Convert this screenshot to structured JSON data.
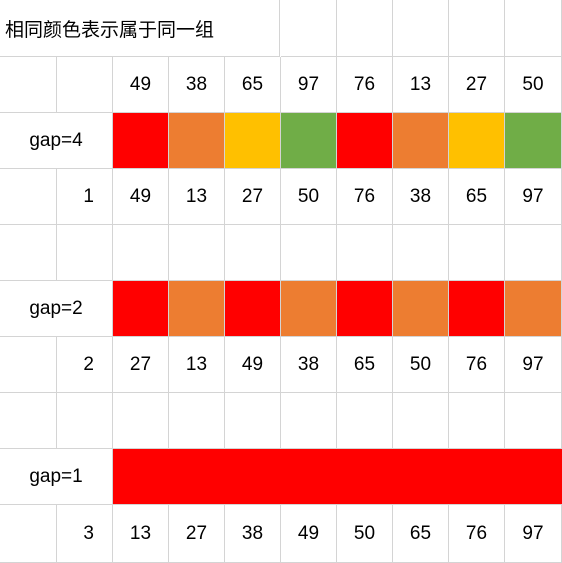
{
  "title": "相同颜色表示属于同一组",
  "colors": {
    "red": "#ff0000",
    "orange": "#ed7d31",
    "yellow": "#ffc000",
    "green": "#70ad47"
  },
  "initial": [
    "49",
    "38",
    "65",
    "97",
    "76",
    "13",
    "27",
    "50"
  ],
  "passes": [
    {
      "label": "gap=4",
      "step": "1",
      "groups": [
        "red",
        "orange",
        "yellow",
        "green",
        "red",
        "orange",
        "yellow",
        "green"
      ],
      "result": [
        "49",
        "13",
        "27",
        "50",
        "76",
        "38",
        "65",
        "97"
      ]
    },
    {
      "label": "gap=2",
      "step": "2",
      "groups": [
        "red",
        "orange",
        "red",
        "orange",
        "red",
        "orange",
        "red",
        "orange"
      ],
      "result": [
        "27",
        "13",
        "49",
        "38",
        "65",
        "50",
        "76",
        "97"
      ]
    },
    {
      "label": "gap=1",
      "step": "3",
      "groups": [
        "red",
        "red",
        "red",
        "red",
        "red",
        "red",
        "red",
        "red"
      ],
      "result": [
        "13",
        "27",
        "38",
        "49",
        "50",
        "65",
        "76",
        "97"
      ]
    }
  ]
}
